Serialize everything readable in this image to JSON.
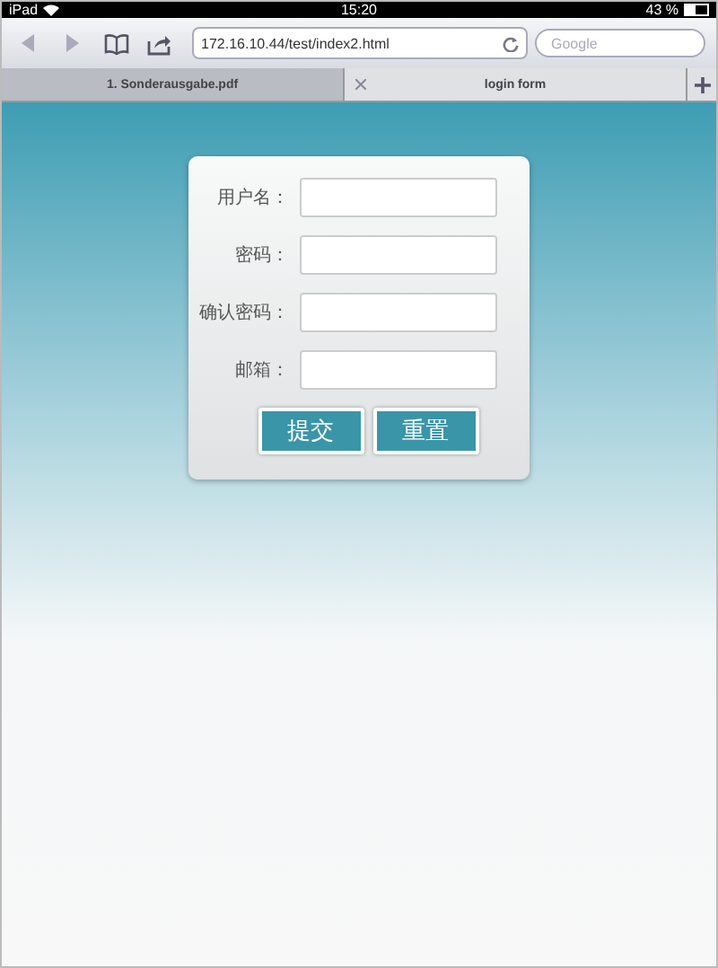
{
  "status_bar": {
    "device": "iPad",
    "time": "15:20",
    "battery": "43 %"
  },
  "toolbar": {
    "url": "172.16.10.44/test/index2.html",
    "search": {
      "placeholder": "Google"
    }
  },
  "tabs": [
    {
      "label": "1. Sonderausgabe.pdf",
      "selected": false,
      "closable": false
    },
    {
      "label": "login form",
      "selected": true,
      "closable": true
    }
  ],
  "form": {
    "fields": [
      {
        "label": "用户名："
      },
      {
        "label": "密码："
      },
      {
        "label": "确认密码："
      },
      {
        "label": "邮箱："
      }
    ],
    "buttons": [
      "提交",
      "重置"
    ]
  }
}
